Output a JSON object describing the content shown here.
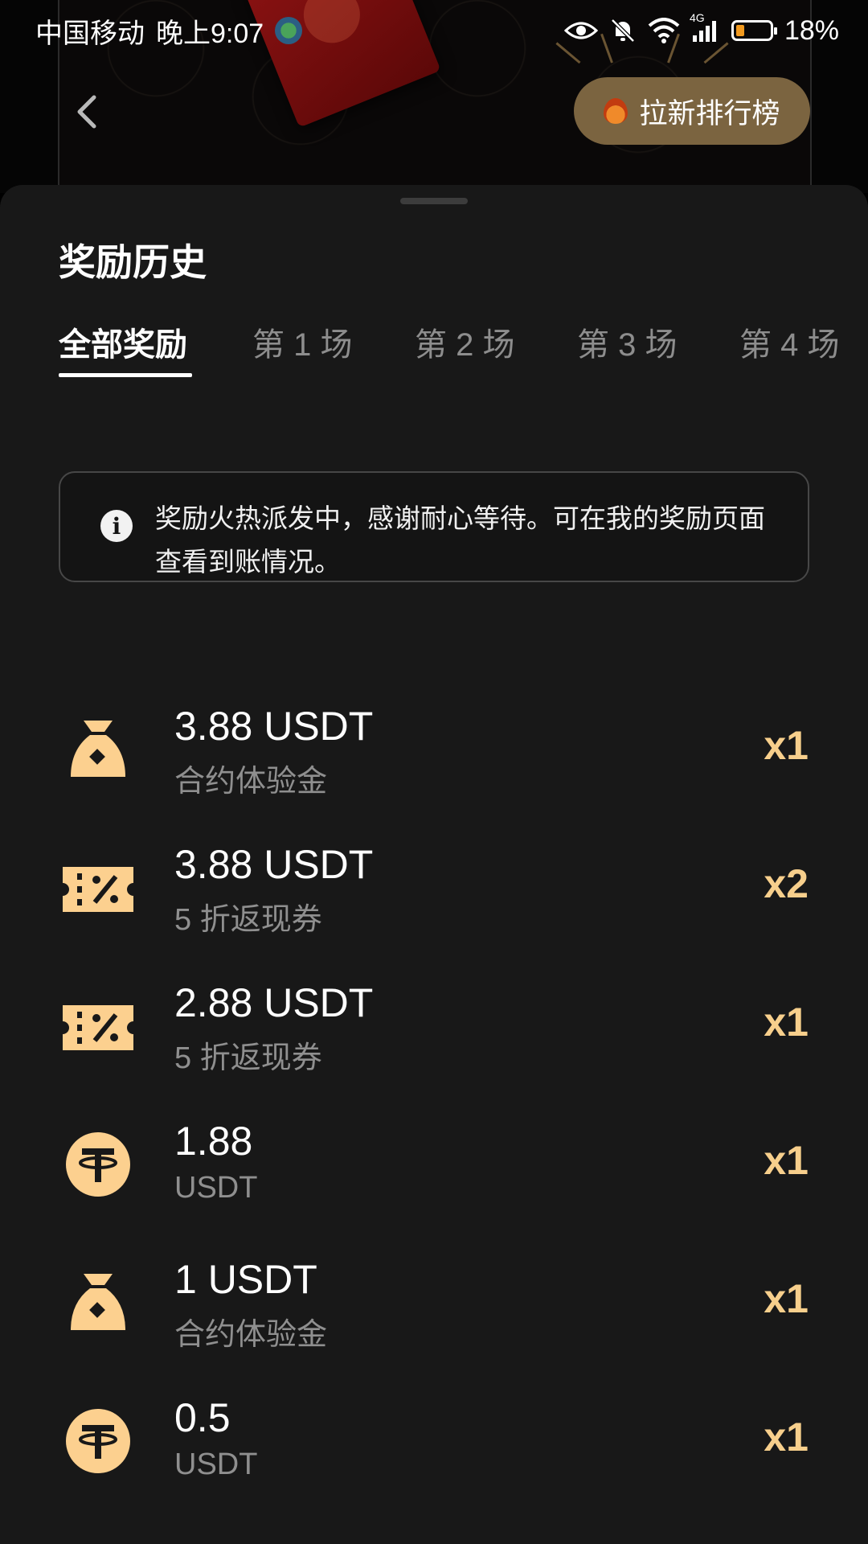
{
  "status_bar": {
    "carrier": "中国移动",
    "time": "晚上9:07",
    "network": "4G",
    "battery": "18%"
  },
  "header": {
    "leaderboard_label": "拉新排行榜"
  },
  "sheet": {
    "title": "奖励历史",
    "tabs": [
      {
        "label": "全部奖励",
        "active": true
      },
      {
        "label": "第 1 场"
      },
      {
        "label": "第 2 场"
      },
      {
        "label": "第 3 场"
      },
      {
        "label": "第 4 场"
      }
    ],
    "notice": "奖励火热派发中，感谢耐心等待。可在我的奖励页面查看到账情况。"
  },
  "rewards": [
    {
      "icon": "money-bag-icon",
      "amount": "3.88 USDT",
      "subtitle": "合约体验金",
      "qty": "x1"
    },
    {
      "icon": "coupon-icon",
      "amount": "3.88 USDT",
      "subtitle": "5 折返现券",
      "qty": "x2"
    },
    {
      "icon": "coupon-icon",
      "amount": "2.88 USDT",
      "subtitle": "5 折返现券",
      "qty": "x1"
    },
    {
      "icon": "tether-icon",
      "amount": "1.88",
      "subtitle": "USDT",
      "qty": "x1"
    },
    {
      "icon": "money-bag-icon",
      "amount": "1 USDT",
      "subtitle": "合约体验金",
      "qty": "x1"
    },
    {
      "icon": "tether-icon",
      "amount": "0.5",
      "subtitle": "USDT",
      "qty": "x1"
    }
  ],
  "colors": {
    "accent": "#f7cf8c",
    "sheet_bg": "#181818",
    "leaderboard_bg": "#7b6440"
  }
}
